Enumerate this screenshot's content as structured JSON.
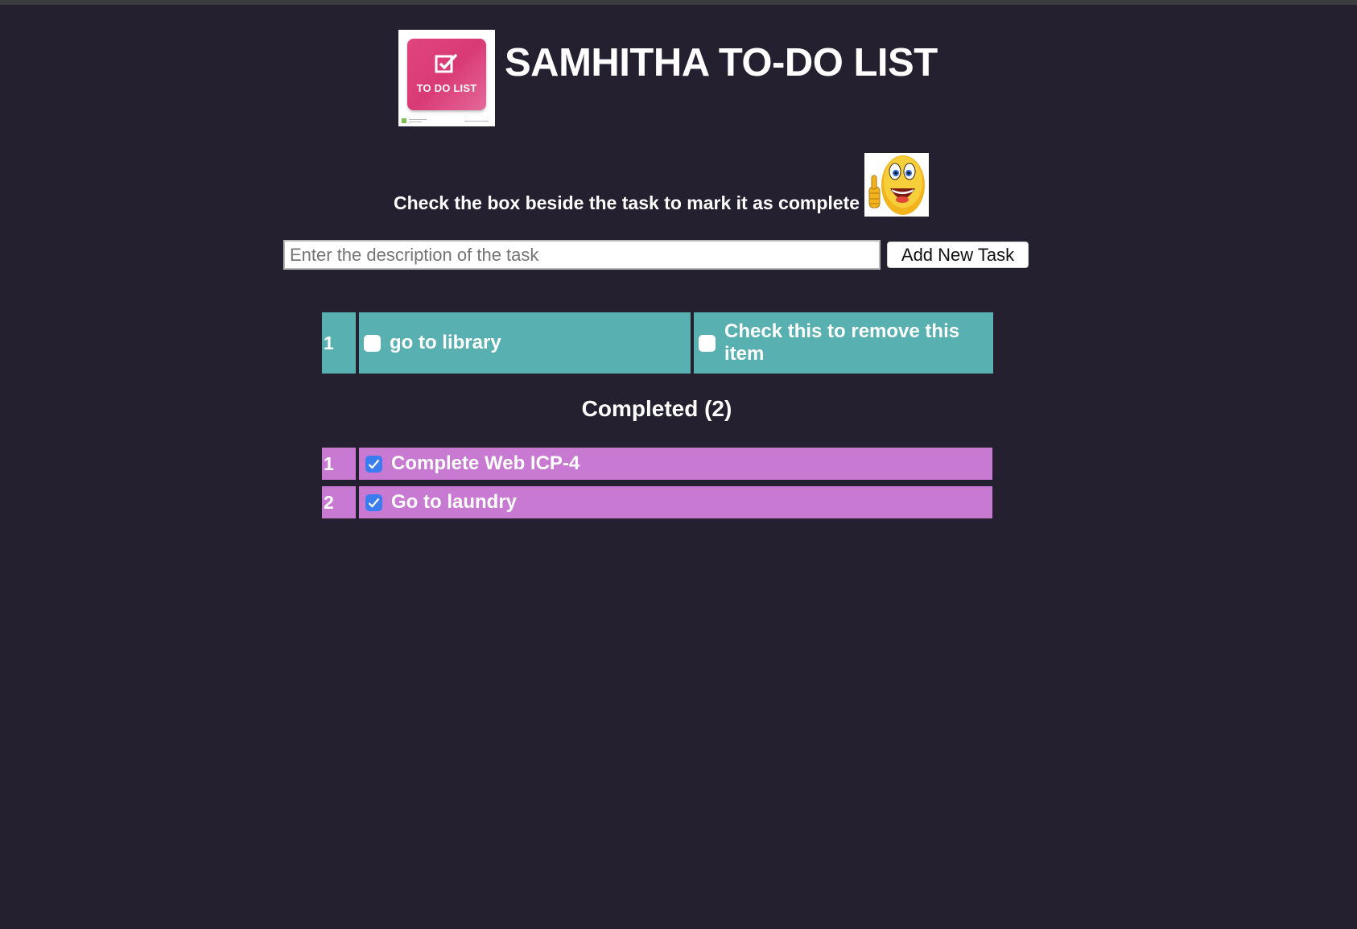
{
  "header": {
    "logo_text": "TO DO LIST",
    "title": "SAMHITHA TO-DO LIST"
  },
  "instruction": "Check the box beside the task to mark it as complete",
  "form": {
    "input_value": "",
    "input_placeholder": "Enter the description of the task",
    "add_button_label": "Add New Task"
  },
  "pending_tasks": [
    {
      "index": "1",
      "label": "go to library",
      "done": false,
      "remove_label": "Check this to remove this item",
      "remove_checked": false
    }
  ],
  "completed": {
    "heading": "Completed (2)",
    "items": [
      {
        "index": "1",
        "label": "Complete Web ICP-4",
        "done": true
      },
      {
        "index": "2",
        "label": "Go to laundry",
        "done": true
      }
    ]
  },
  "colors": {
    "background": "#242030",
    "pending_row": "#59b0b0",
    "completed_row": "#c879d1",
    "checkbox_checked": "#3b7cf0"
  }
}
